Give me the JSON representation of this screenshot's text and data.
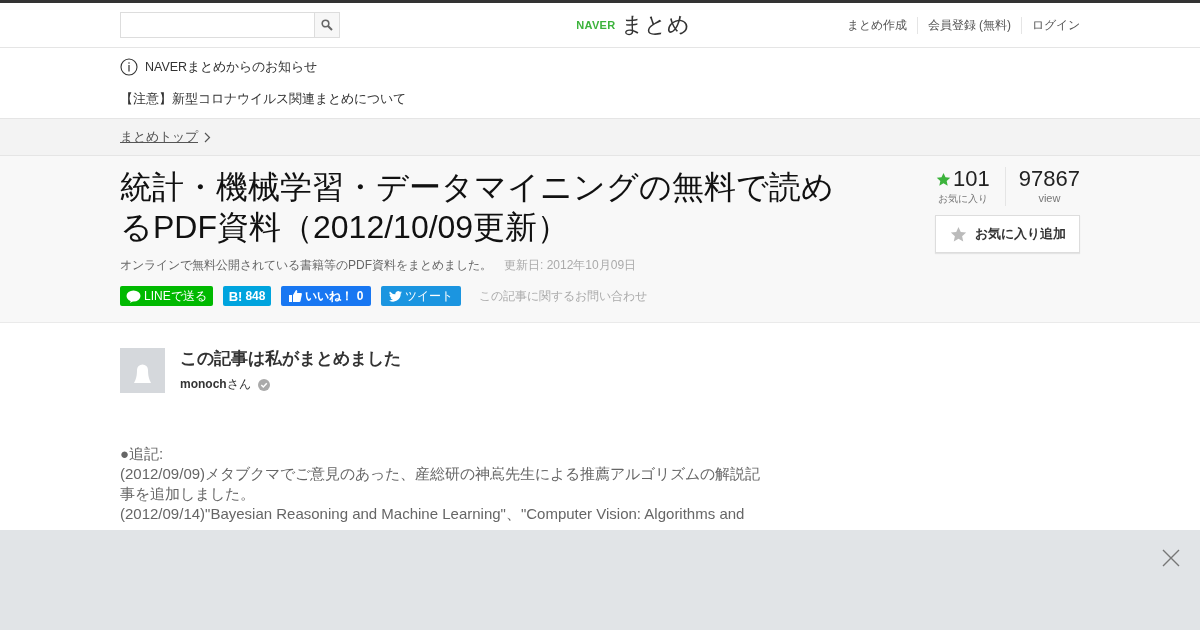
{
  "header": {
    "logo": {
      "brand": "NAVER",
      "name": "まとめ"
    },
    "nav": [
      "まとめ作成",
      "会員登録 (無料)",
      "ログイン"
    ]
  },
  "notice": {
    "title": "NAVERまとめからのお知らせ",
    "link": "【注意】新型コロナウイルス関連まとめについて"
  },
  "breadcrumb": [
    "まとめトップ"
  ],
  "article": {
    "title": "統計・機械学習・データマイニングの無料で読めるPDF資料（2012/10/09更新）",
    "description": "オンラインで無料公開されている書籍等のPDF資料をまとめました。",
    "updated": "更新日: 2012年10月09日",
    "favorites": {
      "count": "101",
      "label": "お気に入り"
    },
    "views": {
      "count": "97867",
      "label": "view"
    },
    "favorite_button": "お気に入り追加",
    "share": [
      {
        "kind": "line",
        "label": "LINEで送る"
      },
      {
        "kind": "hatena",
        "mark": "B!",
        "label": "848"
      },
      {
        "kind": "facebook",
        "label": "いいね！ 0"
      },
      {
        "kind": "twitter",
        "label": "ツイート"
      }
    ],
    "contact": "この記事に関するお問い合わせ"
  },
  "author": {
    "heading": "この記事は私がまとめました",
    "name": "monoch",
    "suffix": "さん",
    "verified": true
  },
  "body": [
    "●追記:",
    "(2012/09/09)メタブクマでご意見のあった、産総研の神嶌先生による推薦アルゴリズムの解説記事を追加しました。",
    "(2012/09/14)\"Bayesian Reasoning and Machine Learning\"、\"Computer Vision: Algorithms and"
  ],
  "ad_bar": {
    "closable": true
  }
}
